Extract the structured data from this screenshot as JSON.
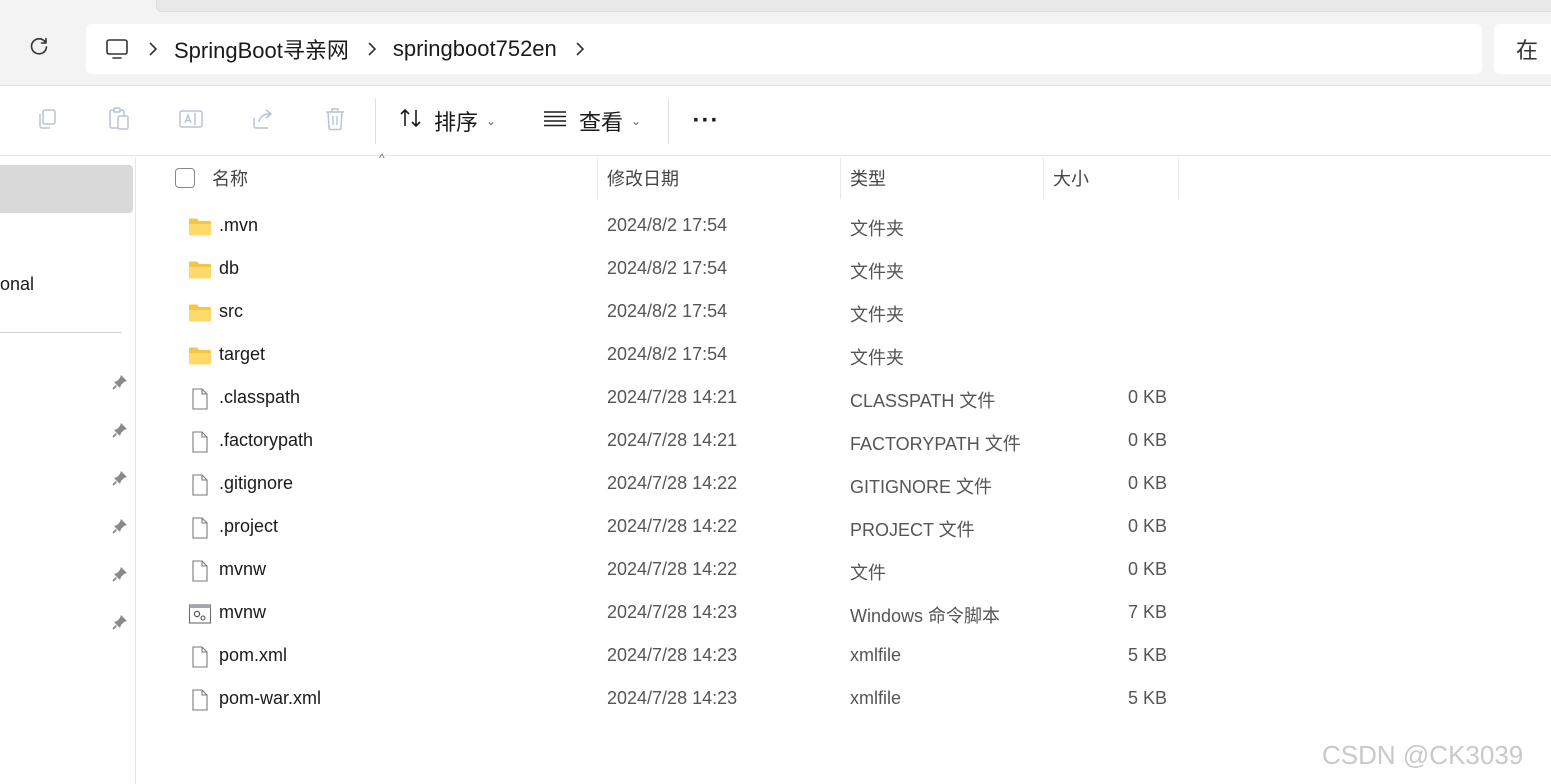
{
  "address_bar": {
    "breadcrumbs": [
      "SpringBoot寻亲网",
      "springboot752en"
    ],
    "search_text": "在"
  },
  "toolbar": {
    "copy_icon": "copy-icon",
    "paste_icon": "paste-icon",
    "rename_icon": "rename-icon",
    "share_icon": "share-icon",
    "delete_icon": "trash-icon",
    "sort_label": "排序",
    "view_label": "查看",
    "more_label": "···"
  },
  "nav_pane": {
    "partial_label": "onal",
    "pinned_count": 6
  },
  "columns": {
    "name": "名称",
    "modified": "修改日期",
    "type": "类型",
    "size": "大小"
  },
  "files": [
    {
      "name": ".mvn",
      "modified": "2024/8/2 17:54",
      "type": "文件夹",
      "size": "",
      "icon": "folder-icon"
    },
    {
      "name": "db",
      "modified": "2024/8/2 17:54",
      "type": "文件夹",
      "size": "",
      "icon": "folder-icon"
    },
    {
      "name": "src",
      "modified": "2024/8/2 17:54",
      "type": "文件夹",
      "size": "",
      "icon": "folder-icon"
    },
    {
      "name": "target",
      "modified": "2024/8/2 17:54",
      "type": "文件夹",
      "size": "",
      "icon": "folder-icon"
    },
    {
      "name": ".classpath",
      "modified": "2024/7/28 14:21",
      "type": "CLASSPATH 文件",
      "size": "0 KB",
      "icon": "file-icon"
    },
    {
      "name": ".factorypath",
      "modified": "2024/7/28 14:21",
      "type": "FACTORYPATH 文件",
      "size": "0 KB",
      "icon": "file-icon"
    },
    {
      "name": ".gitignore",
      "modified": "2024/7/28 14:22",
      "type": "GITIGNORE 文件",
      "size": "0 KB",
      "icon": "file-icon"
    },
    {
      "name": ".project",
      "modified": "2024/7/28 14:22",
      "type": "PROJECT 文件",
      "size": "0 KB",
      "icon": "file-icon"
    },
    {
      "name": "mvnw",
      "modified": "2024/7/28 14:22",
      "type": "文件",
      "size": "0 KB",
      "icon": "file-icon"
    },
    {
      "name": "mvnw",
      "modified": "2024/7/28 14:23",
      "type": "Windows 命令脚本",
      "size": "7 KB",
      "icon": "script-icon"
    },
    {
      "name": "pom.xml",
      "modified": "2024/7/28 14:23",
      "type": "xmlfile",
      "size": "5 KB",
      "icon": "file-icon"
    },
    {
      "name": "pom-war.xml",
      "modified": "2024/7/28 14:23",
      "type": "xmlfile",
      "size": "5 KB",
      "icon": "file-icon"
    }
  ],
  "watermark": "CSDN @CK3039"
}
